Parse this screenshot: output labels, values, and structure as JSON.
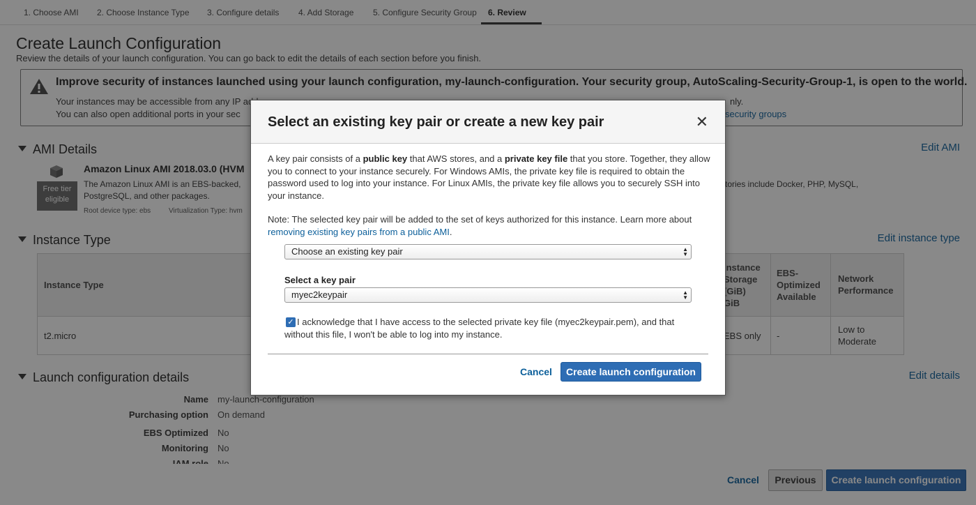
{
  "steps": [
    "1. Choose AMI",
    "2. Choose Instance Type",
    "3. Configure details",
    "4. Add Storage",
    "5. Configure Security Group",
    "6. Review"
  ],
  "page": {
    "title": "Create Launch Configuration",
    "subtitle": "Review the details of your launch configuration. You can go back to edit the details of each section before you finish."
  },
  "warning": {
    "title": "Improve security of instances launched using your launch configuration, my-launch-configuration. Your security group, AutoScaling-Security-Group-1, is open to the world.",
    "line1": "Your instances may be accessible from any IP address.",
    "line1_right": "nly.",
    "line2": "You can also open additional ports in your sec",
    "link": "security groups"
  },
  "ami": {
    "heading": "AMI Details",
    "edit": "Edit AMI",
    "name": "Amazon Linux AMI 2018.03.0 (HVM",
    "desc1": "The Amazon Linux AMI is an EBS-backed,",
    "desc2": "PostgreSQL, and other packages.",
    "desc_right": "tories include Docker, PHP, MySQL,",
    "free_tier_1": "Free tier",
    "free_tier_2": "eligible",
    "root_device": "Root device type: ebs",
    "virt_type": "Virtualization Type: hvm"
  },
  "instance": {
    "heading": "Instance Type",
    "edit": "Edit instance type",
    "col_type": "Instance Type",
    "col_storage": [
      "Instance",
      "Storage",
      "(GiB)",
      "GiB"
    ],
    "col_ebs": [
      "EBS-",
      "Optimized",
      "Available"
    ],
    "col_net": [
      "Network",
      "Performance"
    ],
    "row_type": "t2.micro",
    "row_storage": "EBS only",
    "row_ebs": "-",
    "row_net": [
      "Low to",
      "Moderate"
    ]
  },
  "lc": {
    "heading": "Launch configuration details",
    "edit": "Edit details",
    "rows": [
      {
        "label": "Name",
        "value": "my-launch-configuration"
      },
      {
        "label": "Purchasing option",
        "value": "On demand"
      },
      {
        "label": "EBS Optimized",
        "value": "No"
      },
      {
        "label": "Monitoring",
        "value": "No"
      },
      {
        "label": "IAM role",
        "value": "No"
      }
    ]
  },
  "footer": {
    "cancel": "Cancel",
    "previous": "Previous",
    "create": "Create launch configuration"
  },
  "modal": {
    "title": "Select an existing key pair or create a new key pair",
    "close": "✕",
    "p1_a": "A key pair consists of a ",
    "p1_b": "public key",
    "p1_c": " that AWS stores, and a ",
    "p1_d": "private key file",
    "p1_e": " that you store. Together, they allow you to connect to your instance securely. For Windows AMIs, the private key file is required to obtain the password used to log into your instance. For Linux AMIs, the private key file allows you to securely SSH into your instance.",
    "note": "Note: The selected key pair will be added to the set of keys authorized for this instance. Learn more about ",
    "note_link": "removing existing key pairs from a public AMI",
    "note_end": ".",
    "option_select": "Choose an existing key pair",
    "keypair_label": "Select a key pair",
    "keypair_value": "myec2keypair",
    "ack": "I acknowledge that I have access to the selected private key file (myec2keypair.pem), and that without this file, I won't be able to log into my instance.",
    "ack_checked": true,
    "cancel": "Cancel",
    "create": "Create launch configuration"
  }
}
